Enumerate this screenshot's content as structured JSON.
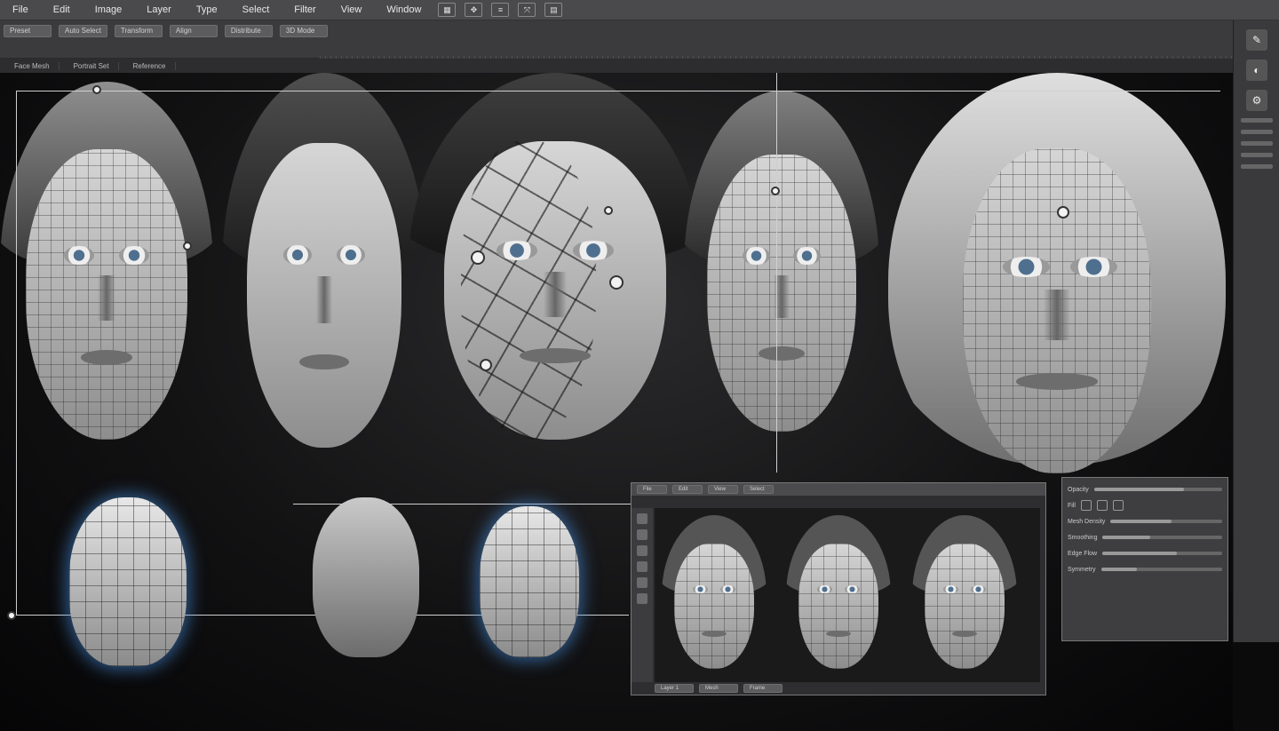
{
  "menu": [
    "File",
    "Edit",
    "Image",
    "Layer",
    "Type",
    "Select",
    "Filter",
    "View",
    "Window"
  ],
  "toolbar_icons": [
    "grid-icon",
    "move-icon",
    "align-icon",
    "transform-icon",
    "layers-icon"
  ],
  "options": [
    "Preset",
    "Auto Select",
    "Transform",
    "Align",
    "Distribute",
    "3D Mode"
  ],
  "tabs": [
    "Face Mesh",
    "Portrait Set",
    "Reference"
  ],
  "subwindow": {
    "header_items": [
      "File",
      "Edit",
      "View",
      "Select"
    ],
    "footer": [
      "Layer 1",
      "Mesh",
      "Frame"
    ]
  },
  "properties": {
    "rows": [
      "Opacity",
      "Fill",
      "Mesh Density",
      "Smoothing",
      "Edge Flow",
      "Symmetry"
    ]
  },
  "colors": {
    "accent_glow": "#4690dc",
    "panel": "#3b3b3d",
    "canvas": "#121213"
  }
}
